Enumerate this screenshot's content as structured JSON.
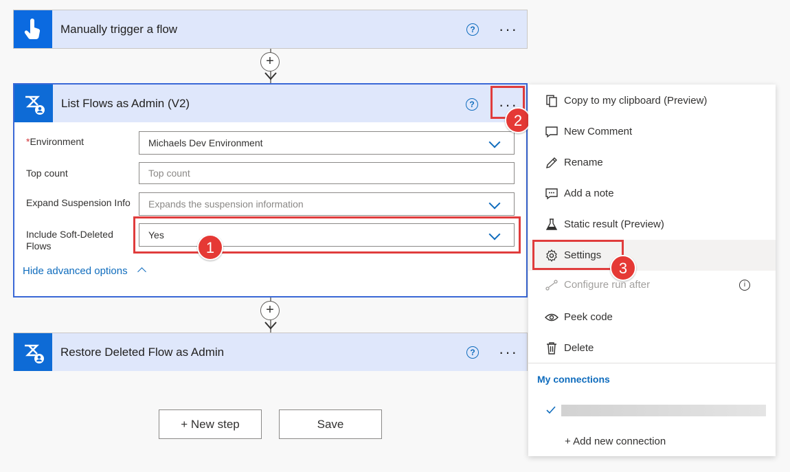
{
  "trigger": {
    "title": "Manually trigger a flow",
    "help": "?",
    "more": "···"
  },
  "list_flows": {
    "title": "List Flows as Admin (V2)",
    "help": "?",
    "more": "···",
    "fields": [
      {
        "label": "Environment",
        "required": "*",
        "value": "Michaels Dev Environment",
        "type": "dropdown"
      },
      {
        "label": "Top count",
        "placeholder": "Top count",
        "type": "text"
      },
      {
        "label": "Expand Suspension Info",
        "placeholder": "Expands the suspension information",
        "type": "dropdown"
      },
      {
        "label_line1": "Include Soft-Deleted",
        "label_line2": "Flows",
        "value": "Yes",
        "type": "dropdown"
      }
    ],
    "advanced_toggle": "Hide advanced options"
  },
  "restore": {
    "title": "Restore Deleted Flow as Admin",
    "help": "?",
    "more": "···"
  },
  "connector_plus": "+",
  "buttons": {
    "new_step": "+ New step",
    "save": "Save"
  },
  "context_menu": {
    "items": [
      {
        "label": "Copy to my clipboard (Preview)",
        "icon": "copy-icon"
      },
      {
        "label": "New Comment",
        "icon": "comment-icon"
      },
      {
        "label": "Rename",
        "icon": "pencil-icon"
      },
      {
        "label": "Add a note",
        "icon": "note-icon"
      },
      {
        "label": "Static result (Preview)",
        "icon": "flask-icon"
      },
      {
        "label": "Settings",
        "icon": "gear-icon"
      },
      {
        "label": "Configure run after",
        "icon": "run-after-icon",
        "disabled": true
      },
      {
        "label": "Peek code",
        "icon": "eye-icon"
      },
      {
        "label": "Delete",
        "icon": "trash-icon"
      }
    ],
    "connections_header": "My connections",
    "add_connection": "+ Add new connection",
    "info": "i"
  },
  "callouts": {
    "one": "1",
    "two": "2",
    "three": "3"
  },
  "colors": {
    "accent": "#0f6cbd",
    "header_bg": "#dfe7fb",
    "callout_red": "#e53935"
  }
}
